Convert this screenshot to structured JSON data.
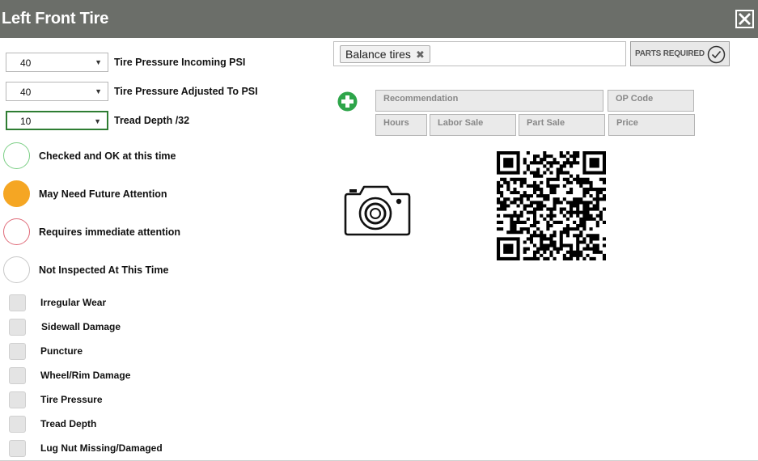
{
  "window": {
    "title": "Left Front Tire",
    "close_label": "close"
  },
  "pressure": [
    {
      "value": "40",
      "label": "Tire Pressure Incoming PSI"
    },
    {
      "value": "40",
      "label": "Tire Pressure Adjusted To PSI"
    },
    {
      "value": "10",
      "label": "Tread Depth /32"
    }
  ],
  "status_options": [
    {
      "label": "Checked and OK at this time",
      "color": "#7ccf86"
    },
    {
      "label": "May Need Future Attention",
      "color": "#f5a623"
    },
    {
      "label": "Requires immediate attention",
      "color": "#e06c7a"
    },
    {
      "label": "Not Inspected At This Time",
      "color": "#c8c8c8"
    }
  ],
  "conditions": [
    {
      "label": "Irregular Wear",
      "checked": false
    },
    {
      "label": "Sidewall Damage",
      "checked": false
    },
    {
      "label": "Puncture",
      "checked": false
    },
    {
      "label": "Wheel/Rim Damage",
      "checked": false
    },
    {
      "label": "Tire Pressure",
      "checked": false
    },
    {
      "label": "Tread Depth",
      "checked": false
    },
    {
      "label": "Lug Nut Missing/Damaged",
      "checked": false
    }
  ],
  "services": {
    "tags": [
      "Balance tires"
    ],
    "remove_symbol": "✖"
  },
  "parts_button": {
    "label": "PARTS REQUIRED",
    "icon": "check-circle-icon"
  },
  "recommendation": {
    "recommendation_placeholder": "Recommendation",
    "op_code_placeholder": "OP Code",
    "hours_placeholder": "Hours",
    "labor_sale_placeholder": "Labor Sale",
    "part_sale_placeholder": "Part Sale",
    "price_placeholder": "Price"
  },
  "icons": {
    "add": "plus-circle-icon",
    "camera": "camera-icon",
    "qr": "qr-code",
    "close": "close-icon"
  },
  "colors": {
    "header": "#6b6e69",
    "add_green": "#2ea54a",
    "select_active": "#2e7d32"
  }
}
